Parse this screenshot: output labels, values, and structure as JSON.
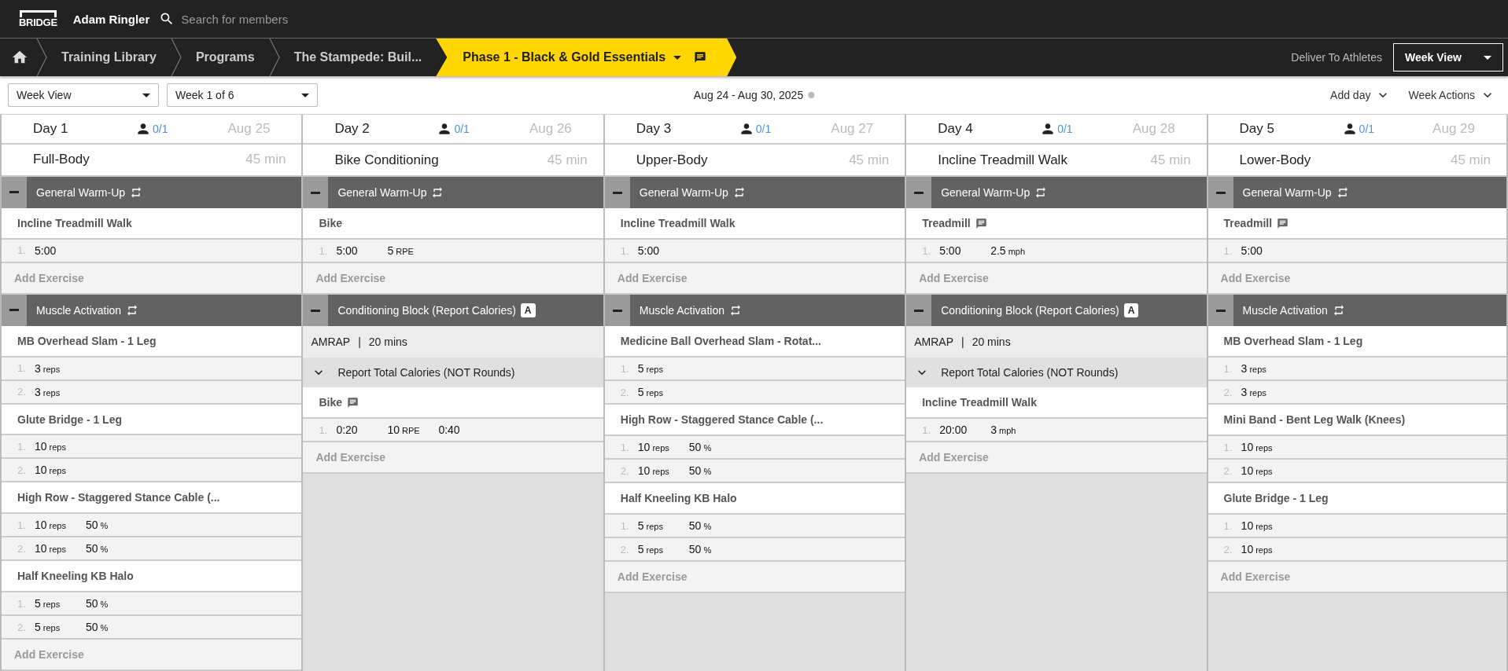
{
  "topbar": {
    "logo": "BRIDGE",
    "user": "Adam Ringler",
    "search": {
      "placeholder": "Search for members"
    }
  },
  "breadcrumbs": [
    {
      "label": "Training Library",
      "selected": false
    },
    {
      "label": "Programs",
      "selected": false
    },
    {
      "label": "The Stampede: Buil...",
      "selected": false
    },
    {
      "label": "Phase 1 - Black & Gold Essentials",
      "selected": true
    }
  ],
  "deliver_link": "Deliver To Athletes",
  "view_select": "Week View",
  "toolbar": {
    "selects": [
      "Week View",
      "Week 1 of 6"
    ],
    "date_range": "Aug 24 - Aug 30, 2025",
    "actions": [
      "Add day",
      "Week Actions"
    ]
  },
  "days": [
    {
      "label": "Day 1",
      "athletes": "0/1",
      "date": "Aug 25",
      "workout": "Full-Body",
      "duration": "45 min",
      "blocks": [
        {
          "kind": "circuit",
          "title": "General Warm-Up",
          "expanded": true,
          "add_label": "Add Exercise",
          "exercises": [
            {
              "name": "Incline Treadmill Walk",
              "note": false,
              "sets": [
                {
                  "number": "1.",
                  "cells": [
                    {
                      "value": "5:00"
                    }
                  ]
                }
              ]
            }
          ]
        },
        {
          "kind": "circuit",
          "title": "Muscle Activation",
          "expanded": true,
          "add_label": "Add Exercise",
          "exercises": [
            {
              "name": "MB Overhead Slam - 1 Leg",
              "note": false,
              "sets": [
                {
                  "number": "1.",
                  "cells": [
                    {
                      "value": "3",
                      "unit": "reps"
                    }
                  ]
                },
                {
                  "number": "2.",
                  "cells": [
                    {
                      "value": "3",
                      "unit": "reps"
                    }
                  ]
                }
              ]
            },
            {
              "name": "Glute Bridge - 1 Leg",
              "note": false,
              "sets": [
                {
                  "number": "1.",
                  "cells": [
                    {
                      "value": "10",
                      "unit": "reps"
                    }
                  ]
                },
                {
                  "number": "2.",
                  "cells": [
                    {
                      "value": "10",
                      "unit": "reps"
                    }
                  ]
                }
              ]
            },
            {
              "name": "High Row - Staggered Stance Cable (...",
              "note": false,
              "sets": [
                {
                  "number": "1.",
                  "cells": [
                    {
                      "value": "10",
                      "unit": "reps"
                    },
                    {
                      "value": "50",
                      "unit": "%"
                    }
                  ]
                },
                {
                  "number": "2.",
                  "cells": [
                    {
                      "value": "10",
                      "unit": "reps"
                    },
                    {
                      "value": "50",
                      "unit": "%"
                    }
                  ]
                }
              ]
            },
            {
              "name": "Half Kneeling KB Halo",
              "note": false,
              "sets": [
                {
                  "number": "1.",
                  "cells": [
                    {
                      "value": "5",
                      "unit": "reps"
                    },
                    {
                      "value": "50",
                      "unit": "%"
                    }
                  ]
                },
                {
                  "number": "2.",
                  "cells": [
                    {
                      "value": "5",
                      "unit": "reps"
                    },
                    {
                      "value": "50",
                      "unit": "%"
                    }
                  ]
                }
              ]
            }
          ]
        }
      ]
    },
    {
      "label": "Day 2",
      "athletes": "0/1",
      "date": "Aug 26",
      "workout": "Bike Conditioning",
      "duration": "45 min",
      "blocks": [
        {
          "kind": "circuit",
          "title": "General Warm-Up",
          "expanded": true,
          "add_label": "Add Exercise",
          "exercises": [
            {
              "name": "Bike",
              "note": false,
              "sets": [
                {
                  "number": "1.",
                  "cells": [
                    {
                      "value": "5:00"
                    },
                    {
                      "value": "5",
                      "unit": "RPE"
                    }
                  ]
                }
              ]
            }
          ]
        },
        {
          "kind": "conditioning",
          "title": "Conditioning Block (Report Calories)",
          "badge": "A",
          "expanded": true,
          "scheme": "AMRAP",
          "scheme_separator": "|",
          "scheme_duration": "20 mins",
          "section": {
            "title": "Report Total Calories (NOT Rounds)",
            "expanded": true
          },
          "add_label": "Add Exercise",
          "exercises": [
            {
              "name": "Bike",
              "note": true,
              "sets": [
                {
                  "number": "1.",
                  "cells": [
                    {
                      "value": "0:20"
                    },
                    {
                      "value": "10",
                      "unit": "RPE"
                    },
                    {
                      "value": "0:40"
                    }
                  ]
                }
              ]
            }
          ]
        }
      ]
    },
    {
      "label": "Day 3",
      "athletes": "0/1",
      "date": "Aug 27",
      "workout": "Upper-Body",
      "duration": "45 min",
      "blocks": [
        {
          "kind": "circuit",
          "title": "General Warm-Up",
          "expanded": true,
          "add_label": "Add Exercise",
          "exercises": [
            {
              "name": "Incline Treadmill Walk",
              "note": false,
              "sets": [
                {
                  "number": "1.",
                  "cells": [
                    {
                      "value": "5:00"
                    }
                  ]
                }
              ]
            }
          ]
        },
        {
          "kind": "circuit",
          "title": "Muscle Activation",
          "expanded": true,
          "add_label": "Add Exercise",
          "exercises": [
            {
              "name": "Medicine Ball Overhead Slam - Rotat...",
              "note": false,
              "sets": [
                {
                  "number": "1.",
                  "cells": [
                    {
                      "value": "5",
                      "unit": "reps"
                    }
                  ]
                },
                {
                  "number": "2.",
                  "cells": [
                    {
                      "value": "5",
                      "unit": "reps"
                    }
                  ]
                }
              ]
            },
            {
              "name": "High Row - Staggered Stance Cable (...",
              "note": false,
              "sets": [
                {
                  "number": "1.",
                  "cells": [
                    {
                      "value": "10",
                      "unit": "reps"
                    },
                    {
                      "value": "50",
                      "unit": "%"
                    }
                  ]
                },
                {
                  "number": "2.",
                  "cells": [
                    {
                      "value": "10",
                      "unit": "reps"
                    },
                    {
                      "value": "50",
                      "unit": "%"
                    }
                  ]
                }
              ]
            },
            {
              "name": "Half Kneeling KB Halo",
              "note": false,
              "sets": [
                {
                  "number": "1.",
                  "cells": [
                    {
                      "value": "5",
                      "unit": "reps"
                    },
                    {
                      "value": "50",
                      "unit": "%"
                    }
                  ]
                },
                {
                  "number": "2.",
                  "cells": [
                    {
                      "value": "5",
                      "unit": "reps"
                    },
                    {
                      "value": "50",
                      "unit": "%"
                    }
                  ]
                }
              ]
            }
          ]
        }
      ]
    },
    {
      "label": "Day 4",
      "athletes": "0/1",
      "date": "Aug 28",
      "workout": "Incline Treadmill Walk",
      "duration": "45 min",
      "blocks": [
        {
          "kind": "circuit",
          "title": "General Warm-Up",
          "expanded": true,
          "add_label": "Add Exercise",
          "exercises": [
            {
              "name": "Treadmill",
              "note": true,
              "sets": [
                {
                  "number": "1.",
                  "cells": [
                    {
                      "value": "5:00"
                    },
                    {
                      "value": "2.5",
                      "unit": "mph"
                    }
                  ]
                }
              ]
            }
          ]
        },
        {
          "kind": "conditioning",
          "title": "Conditioning Block (Report Calories)",
          "badge": "A",
          "expanded": true,
          "scheme": "AMRAP",
          "scheme_separator": "|",
          "scheme_duration": "20 mins",
          "section": {
            "title": "Report Total Calories (NOT Rounds)",
            "expanded": true
          },
          "add_label": "Add Exercise",
          "exercises": [
            {
              "name": "Incline Treadmill Walk",
              "note": false,
              "sets": [
                {
                  "number": "1.",
                  "cells": [
                    {
                      "value": "20:00"
                    },
                    {
                      "value": "3",
                      "unit": "mph"
                    }
                  ]
                }
              ]
            }
          ]
        }
      ]
    },
    {
      "label": "Day 5",
      "athletes": "0/1",
      "date": "Aug 29",
      "workout": "Lower-Body",
      "duration": "45 min",
      "blocks": [
        {
          "kind": "circuit",
          "title": "General Warm-Up",
          "expanded": true,
          "add_label": "Add Exercise",
          "exercises": [
            {
              "name": "Treadmill",
              "note": true,
              "sets": [
                {
                  "number": "1.",
                  "cells": [
                    {
                      "value": "5:00"
                    }
                  ]
                }
              ]
            }
          ]
        },
        {
          "kind": "circuit",
          "title": "Muscle Activation",
          "expanded": true,
          "add_label": "Add Exercise",
          "exercises": [
            {
              "name": "MB Overhead Slam - 1 Leg",
              "note": false,
              "sets": [
                {
                  "number": "1.",
                  "cells": [
                    {
                      "value": "3",
                      "unit": "reps"
                    }
                  ]
                },
                {
                  "number": "2.",
                  "cells": [
                    {
                      "value": "3",
                      "unit": "reps"
                    }
                  ]
                }
              ]
            },
            {
              "name": "Mini Band - Bent Leg Walk (Knees)",
              "note": false,
              "sets": [
                {
                  "number": "1.",
                  "cells": [
                    {
                      "value": "10",
                      "unit": "reps"
                    }
                  ]
                },
                {
                  "number": "2.",
                  "cells": [
                    {
                      "value": "10",
                      "unit": "reps"
                    }
                  ]
                }
              ]
            },
            {
              "name": "Glute Bridge - 1 Leg",
              "note": false,
              "sets": [
                {
                  "number": "1.",
                  "cells": [
                    {
                      "value": "10",
                      "unit": "reps"
                    }
                  ]
                },
                {
                  "number": "2.",
                  "cells": [
                    {
                      "value": "10",
                      "unit": "reps"
                    }
                  ]
                }
              ]
            }
          ]
        }
      ]
    }
  ]
}
